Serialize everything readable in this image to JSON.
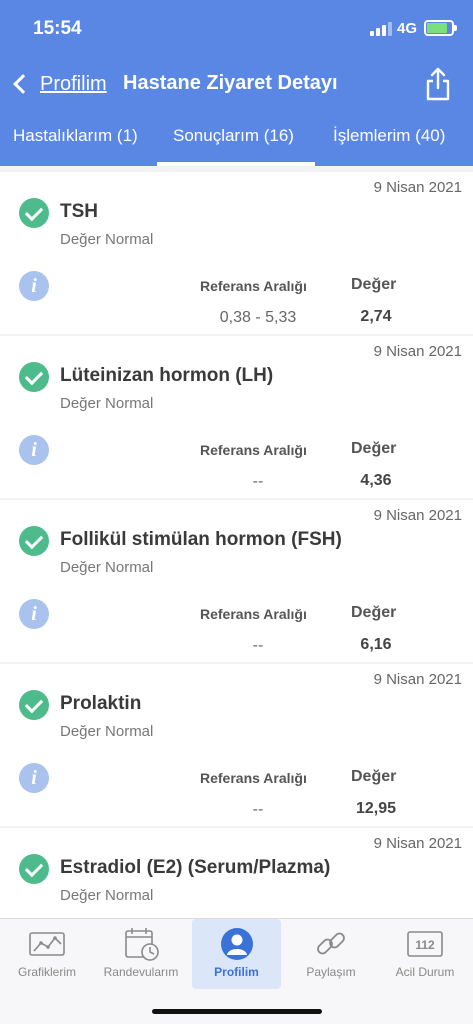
{
  "status_bar": {
    "time": "15:54",
    "network": "4G"
  },
  "nav": {
    "back_label": "Profilim",
    "title": "Hastane Ziyaret Detayı"
  },
  "tabs": [
    {
      "label": "Hastalıklarım (1)"
    },
    {
      "label": "Sonuçlarım (16)",
      "selected": true
    },
    {
      "label": "İşlemlerim (40)"
    }
  ],
  "results": [
    {
      "date": "9 Nisan 2021",
      "name": "TSH",
      "status": "Değer Normal",
      "ref_header": "Referans Aralığı",
      "value_header": "Değer",
      "ref": "0,38 - 5,33",
      "value": "2,74"
    },
    {
      "date": "9 Nisan 2021",
      "name": "Lüteinizan hormon (LH)",
      "status": "Değer Normal",
      "ref_header": "Referans Aralığı",
      "value_header": "Değer",
      "ref": "--",
      "value": "4,36"
    },
    {
      "date": "9 Nisan 2021",
      "name": "Follikül stimülan hormon (FSH)",
      "status": "Değer Normal",
      "ref_header": "Referans Aralığı",
      "value_header": "Değer",
      "ref": "--",
      "value": "6,16"
    },
    {
      "date": "9 Nisan 2021",
      "name": "Prolaktin",
      "status": "Değer Normal",
      "ref_header": "Referans Aralığı",
      "value_header": "Değer",
      "ref": "--",
      "value": "12,95"
    },
    {
      "date": "9 Nisan 2021",
      "name": "Estradiol (E2) (Serum/Plazma)",
      "status": "Değer Normal"
    }
  ],
  "info_icon_glyph": "i",
  "tabbar": [
    {
      "label": "Grafiklerim",
      "icon": "chart-icon"
    },
    {
      "label": "Randevularım",
      "icon": "calendar-clock-icon"
    },
    {
      "label": "Profilim",
      "icon": "profile-icon",
      "active": true
    },
    {
      "label": "Paylaşım",
      "icon": "link-icon"
    },
    {
      "label": "Acil Durum",
      "icon": "emergency-112-icon",
      "badge": "112"
    }
  ],
  "colors": {
    "header": "#5b87e4",
    "check": "#4dbb8c",
    "info": "#a9c3ee",
    "active_tab": "#3a73d8"
  }
}
